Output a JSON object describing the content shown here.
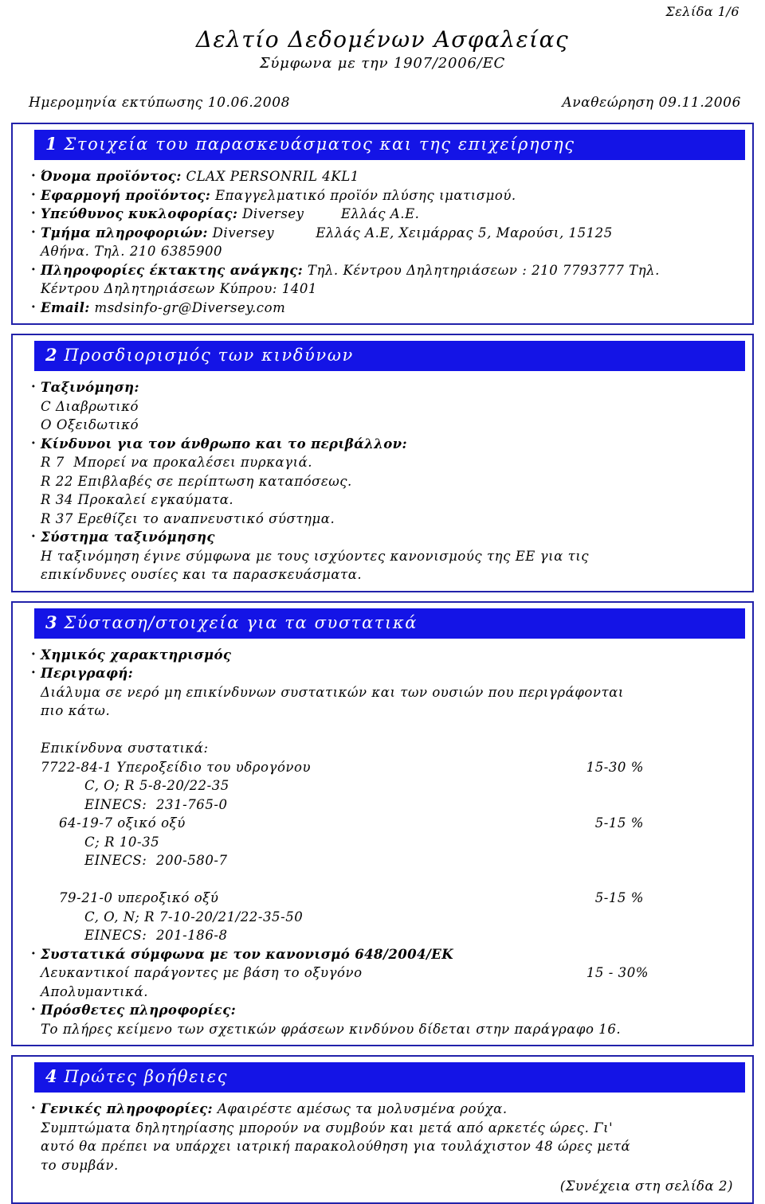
{
  "header": {
    "page_number": "Σελίδα 1/6",
    "title": "Δελτίο Δεδομένων Ασφαλείας",
    "subtitle": "Σύμφωνα με την 1907/2006/EC",
    "print_date": "Ημερομηνία εκτύπωσης 10.06.2008",
    "revision": "Αναθεώρηση 09.11.2006"
  },
  "colors": {
    "section_header_bg": "#1414e6",
    "section_border": "#2222aa",
    "text": "#000000",
    "header_text": "#ffffff"
  },
  "sections": [
    {
      "number": "1",
      "title": "Στοιχεία του παρασκευάσματος και της επιχείρησης",
      "rows": {
        "product_name_label": "Όνομα προϊόντος:",
        "product_name_value": " CLAX PERSONRIL 4KL1",
        "application_label": "Εφαρμογή προϊόντος:",
        "application_value": " Επαγγελματικό προϊόν πλύσης ιματισμού.",
        "supplier_label": "Υπεύθυνος κυκλοφορίας:",
        "supplier_value": " Diversey        Ελλάς Α.Ε.",
        "info_dept_label": "Τμήμα πληροφοριών:",
        "info_dept_value": " Diversey         Ελλάς Α.Ε, Χειμάρρας 5, Μαρούσι, 15125",
        "info_dept_value_line2": "Αθήνα. Τηλ. 210 6385900",
        "emergency_label": "Πληροφορίες έκτακτης ανάγκης:",
        "emergency_value": " Τηλ. Κέντρου Δηλητηριάσεων : 210 7793777 Τηλ.",
        "emergency_value_line2": "Κέντρου Δηλητηριάσεων Κύπρου: 1401",
        "email_label": "Email:",
        "email_value": " msdsinfo-gr@Diversey.com"
      }
    },
    {
      "number": "2",
      "title": "Προσδιορισμός των κινδύνων",
      "rows": {
        "classification_label": "Ταξινόμηση:",
        "classification_items": [
          "C Διαβρωτικό",
          "O Οξειδωτικό"
        ],
        "hazards_label": "Κίνδυνοι για τον άνθρωπο και το περιβάλλον:",
        "hazard_phrases": [
          "R 7  Μπορεί να προκαλέσει πυρκαγιά.",
          "R 22 Επιβλαβές σε περίπτωση καταπόσεως.",
          "R 34 Προκαλεί εγκαύματα.",
          "R 37 Ερεθίζει το αναπνευστικό σύστημα."
        ],
        "system_label": "Σύστημα ταξινόμησης",
        "system_text_line1": "Η ταξινόμηση έγινε σύμφωνα με τους ισχύοντες κανονισμούς της ΕΕ για τις",
        "system_text_line2": "επικίνδυνες ουσίες και τα παρασκευάσματα."
      }
    },
    {
      "number": "3",
      "title": "Σύσταση/στοιχεία για τα συστατικά",
      "rows": {
        "chemical_label": "Χημικός χαρακτηρισμός",
        "description_label": "Περιγραφή:",
        "description_line1": "Διάλυμα σε νερό μη επικίνδυνων συστατικών και των ουσιών που περιγράφονται",
        "description_line2": "πιο κάτω.",
        "hazardous_heading": "Επικίνδυνα συστατικά:",
        "components": [
          {
            "cas": "7722-84-1 Υπεροξείδιο του υδρογόνου",
            "amount": "15-30 %",
            "classification": "C, O; R 5-8-20/22-35",
            "einecs": "EINECS:  231-765-0",
            "indent": "0"
          },
          {
            "cas": "64-19-7 οξικό οξύ",
            "amount": "5-15 %",
            "classification": "C; R 10-35",
            "einecs": "EINECS:  200-580-7",
            "indent": "1"
          },
          {
            "cas": "79-21-0 υπεροξικό οξύ",
            "amount": "5-15 %",
            "classification": "C, O, N; R 7-10-20/21/22-35-50",
            "einecs": "EINECS:  201-186-8",
            "indent": "1"
          }
        ],
        "regulation_label": "Συστατικά σύμφωνα με τον κανονισμό 648/2004/ΕΚ",
        "regulation_item": "Λευκαντικοί παράγοντες με βάση το οξυγόνο",
        "regulation_amount": "15 - 30%",
        "regulation_item2": "Απολυμαντικά.",
        "additional_label": "Πρόσθετες πληροφορίες:",
        "additional_text": "Το πλήρες κείμενο των σχετικών φράσεων κινδύνου δίδεται στην παράγραφο 16."
      }
    },
    {
      "number": "4",
      "title": "Πρώτες βοήθειες",
      "rows": {
        "general_label": "Γενικές πληροφορίες:",
        "general_value": " Αφαιρέστε αμέσως τα μολυσμένα ρούχα.",
        "general_line1": "Συμπτώματα δηλητηρίασης μπορούν να συμβούν και μετά από αρκετές ώρες. Γι'",
        "general_line2": "αυτό θα πρέπει να υπάρχει ιατρική παρακολούθηση για τουλάχιστον 48 ώρες μετά",
        "general_line3": "το συμβάν.",
        "continuation": "(Συνέχεια στη σελίδα 2)"
      }
    }
  ]
}
